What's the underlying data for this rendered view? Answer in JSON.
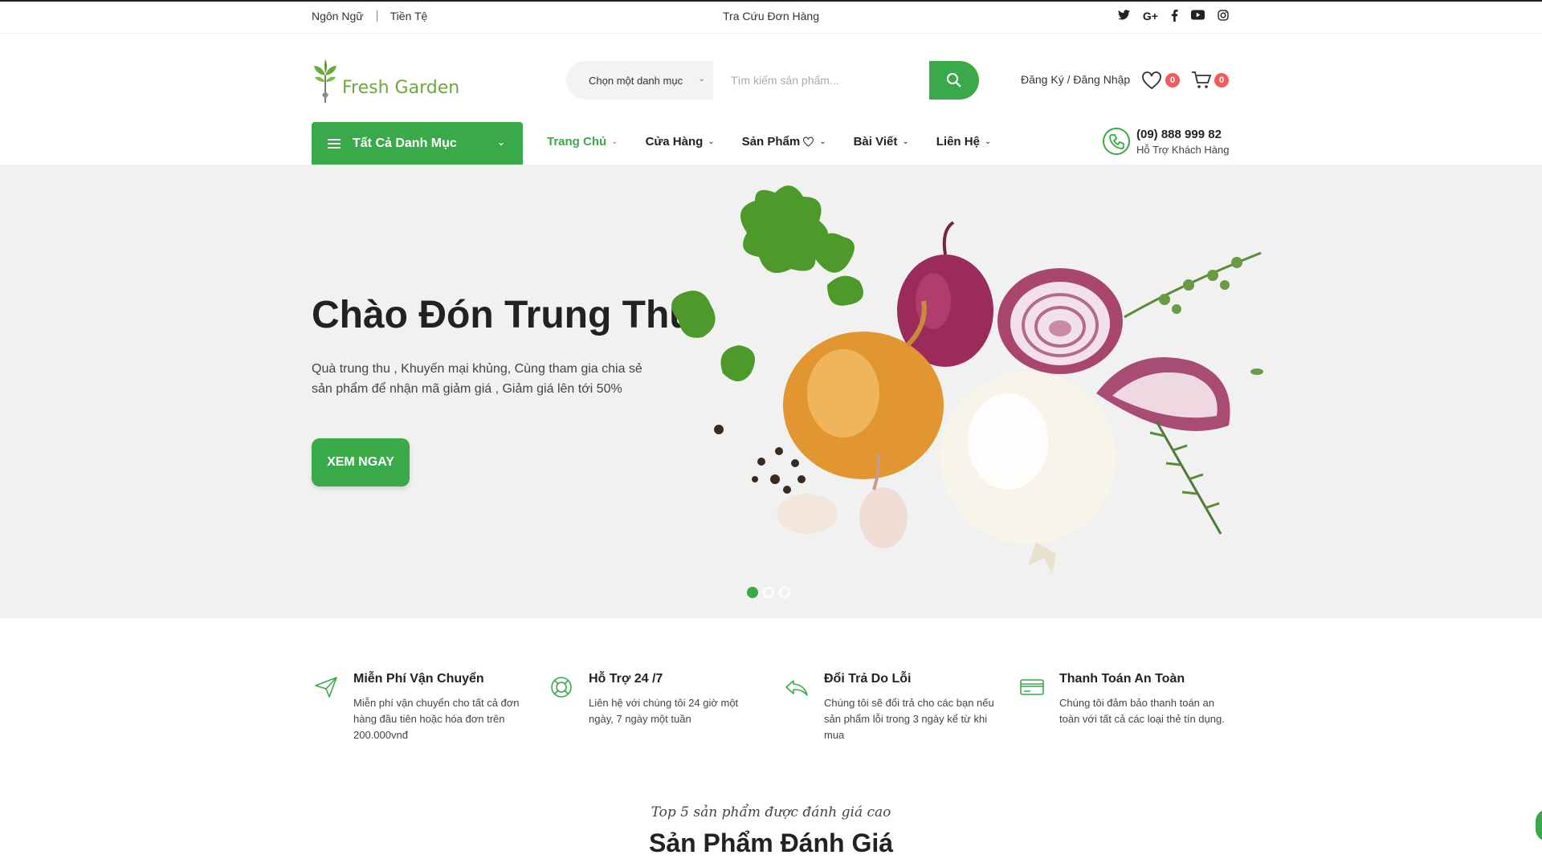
{
  "topbar": {
    "language": "Ngôn Ngữ",
    "currency": "Tiền Tệ",
    "order_lookup": "Tra Cứu Đơn Hàng",
    "social": [
      "twitter-icon",
      "google-plus-icon",
      "facebook-icon",
      "youtube-icon",
      "instagram-icon"
    ]
  },
  "header": {
    "logo_text": "Fresh Garden",
    "search": {
      "category_label": "Chọn một danh mục",
      "placeholder": "Tìm kiếm sản phẩm..."
    },
    "account_label": "Đăng Ký / Đăng Nhập",
    "wishlist_count": "0",
    "cart_count": "0"
  },
  "nav": {
    "all_categories": "Tất Cả Danh Mục",
    "items": [
      {
        "label": "Trang Chủ",
        "active": true
      },
      {
        "label": "Cửa Hàng",
        "active": false
      },
      {
        "label": "Sản Phẩm",
        "active": false
      },
      {
        "label": "Bài Viết",
        "active": false
      },
      {
        "label": "Liên Hệ",
        "active": false
      }
    ],
    "support_phone": "(09) 888 999 82",
    "support_label": "Hỗ Trợ Khách Hàng"
  },
  "hero": {
    "title": "Chào Đón Trung Thu",
    "description": "Quà trung thu , Khuyến mại khủng, Cùng tham gia chia sẻ sản phẩm để nhận mã giảm giá , Giảm giá lên tới 50%",
    "button": "XEM NGAY",
    "slides": 3,
    "active_slide": 1
  },
  "features": [
    {
      "icon": "airplane-icon",
      "title": "Miễn Phí Vận Chuyển",
      "desc": "Miễn phí vận chuyển cho tất cả đơn hàng đầu tiên hoặc hóa đơn trên 200.000vnđ"
    },
    {
      "icon": "lifebuoy-icon",
      "title": "Hỗ Trợ 24 /7",
      "desc": "Liên hệ với chúng tôi 24 giờ một ngày, 7 ngày một tuần"
    },
    {
      "icon": "return-arrow-icon",
      "title": "Đổi Trả Do Lỗi",
      "desc": "Chúng tôi sẽ đổi trả cho các bạn nếu sản phẩm lỗi trong 3 ngày kể từ khi mua"
    },
    {
      "icon": "credit-card-icon",
      "title": "Thanh Toán An Toàn",
      "desc": "Chúng tôi đảm bảo thanh toán an toàn với tất cả các loại thẻ tín dụng."
    }
  ],
  "section": {
    "subtitle": "Top 5 sản phẩm được đánh giá cao",
    "title": "Sản Phẩm Đánh Giá"
  },
  "colors": {
    "accent": "#3aa94a",
    "badge": "#f35c5c",
    "hero_bg": "#f1f1f1"
  }
}
